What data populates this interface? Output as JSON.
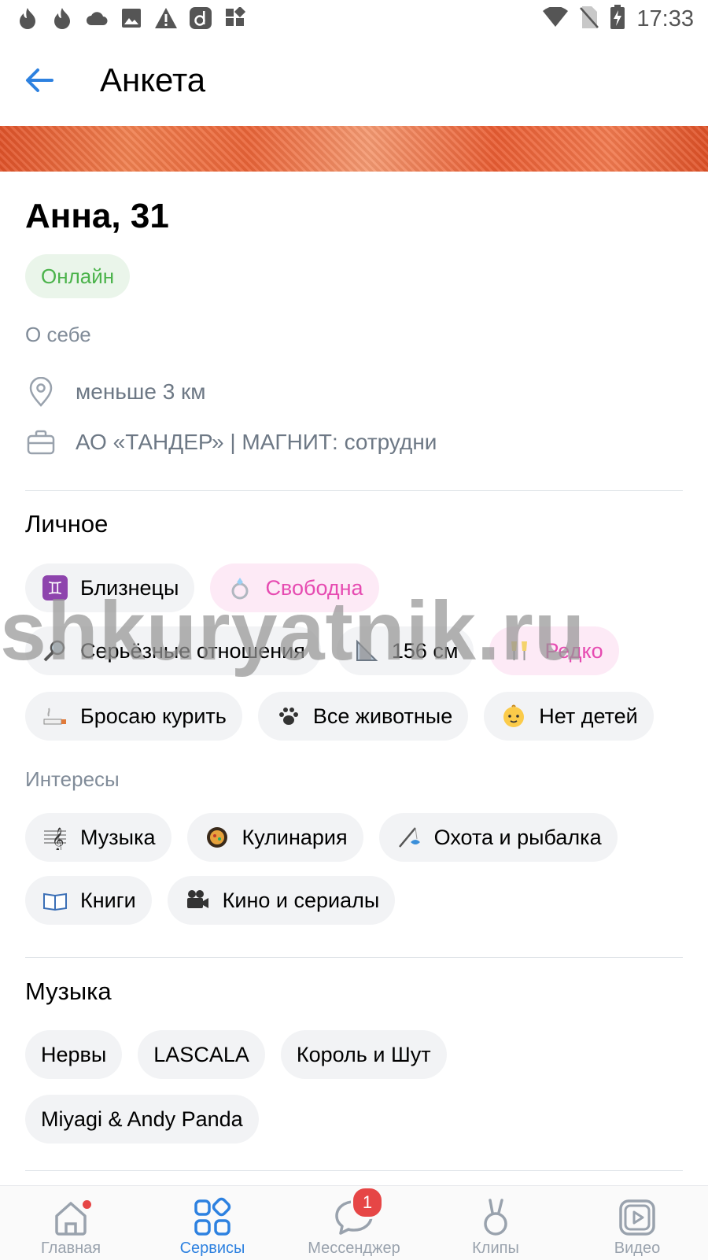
{
  "status_bar": {
    "time": "17:33",
    "left_icons": [
      "flame-icon",
      "flame-icon",
      "cloud-icon",
      "image-icon",
      "warning-icon",
      "app-d-icon",
      "widgets-icon"
    ],
    "right_icons": [
      "wifi-icon",
      "no-sim-icon",
      "battery-charging-icon"
    ]
  },
  "header": {
    "title": "Анкета"
  },
  "colors": {
    "accent": "#2d81e0",
    "online_green": "#4bb34b",
    "pink": "#e64bb1",
    "badge_red": "#e64646"
  },
  "profile": {
    "name_age": "Анна, 31",
    "status": "Онлайн",
    "about_label": "О себе",
    "distance": "меньше 3 км",
    "work": "АО «ТАНДЕР» | МАГНИТ: сотрудни"
  },
  "personal": {
    "title": "Личное",
    "chips": [
      {
        "emoji": "♊",
        "label": "Близнецы"
      },
      {
        "emoji": "💍",
        "label": "Свободна"
      },
      {
        "emoji": "🔍",
        "label": "Серьёзные отношения"
      },
      {
        "emoji": "📐",
        "label": "156 см"
      },
      {
        "emoji": "🥂",
        "label": "Редко"
      },
      {
        "emoji": "🚬",
        "label": "Бросаю курить"
      },
      {
        "emoji": "🐾",
        "label": "Все животные"
      },
      {
        "emoji": "👶",
        "label": "Нет детей"
      }
    ]
  },
  "interests": {
    "label": "Интересы",
    "chips": [
      {
        "emoji": "🎼",
        "label": "Музыка"
      },
      {
        "emoji": "🥘",
        "label": "Кулинария"
      },
      {
        "emoji": "🎣",
        "label": "Охота и рыбалка"
      },
      {
        "emoji": "📖",
        "label": "Книги"
      },
      {
        "emoji": "🎥",
        "label": "Кино и сериалы"
      }
    ]
  },
  "music": {
    "title": "Музыка",
    "chips": [
      "Нервы",
      "LASCALA",
      "Король и Шут",
      "Miyagi & Andy Panda"
    ]
  },
  "watermark": "shkuryatnik.ru",
  "tabbar": {
    "tabs": [
      {
        "label": "Главная",
        "icon": "home-icon"
      },
      {
        "label": "Сервисы",
        "icon": "services-icon"
      },
      {
        "label": "Мессенджер",
        "icon": "messenger-icon",
        "badge": "1"
      },
      {
        "label": "Клипы",
        "icon": "clips-icon"
      },
      {
        "label": "Видео",
        "icon": "video-icon"
      }
    ]
  }
}
